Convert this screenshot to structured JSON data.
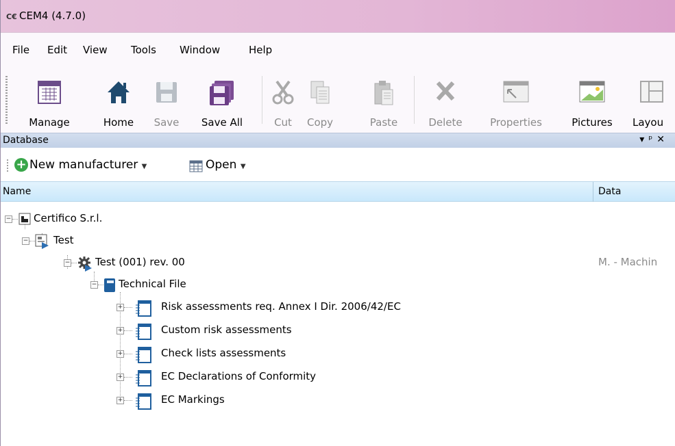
{
  "window": {
    "title": "CEM4 (4.7.0)",
    "icon": "ce-logo-icon"
  },
  "menu": [
    "File",
    "Edit",
    "View",
    "Tools",
    "Window",
    "Help"
  ],
  "toolbar": {
    "manage": "Manage",
    "home": "Home",
    "save": "Save",
    "save_all": "Save All",
    "cut": "Cut",
    "copy": "Copy",
    "paste": "Paste",
    "delete": "Delete",
    "properties": "Properties",
    "pictures": "Pictures",
    "layout": "Layou"
  },
  "panel": {
    "title": "Database",
    "buttons": "▾ ᵖ ✕",
    "new_manufacturer": "New manufacturer",
    "open": "Open",
    "col_name": "Name",
    "col_data": "Data"
  },
  "tree": {
    "company": "Certifico S.r.l.",
    "project": "Test",
    "machine": "Test (001) rev. 00",
    "machine_data": "M. - Machin",
    "technical_file": "Technical File",
    "children": [
      "Risk assessments req. Annex I Dir. 2006/42/EC",
      "Custom risk assessments",
      "Check lists assessments",
      "EC Declarations of Conformity",
      "EC Markings"
    ]
  },
  "colors": {
    "title_bar": "#e3b6d6",
    "panel_header": "#c9d7ec",
    "column_header": "#d6eefc"
  }
}
